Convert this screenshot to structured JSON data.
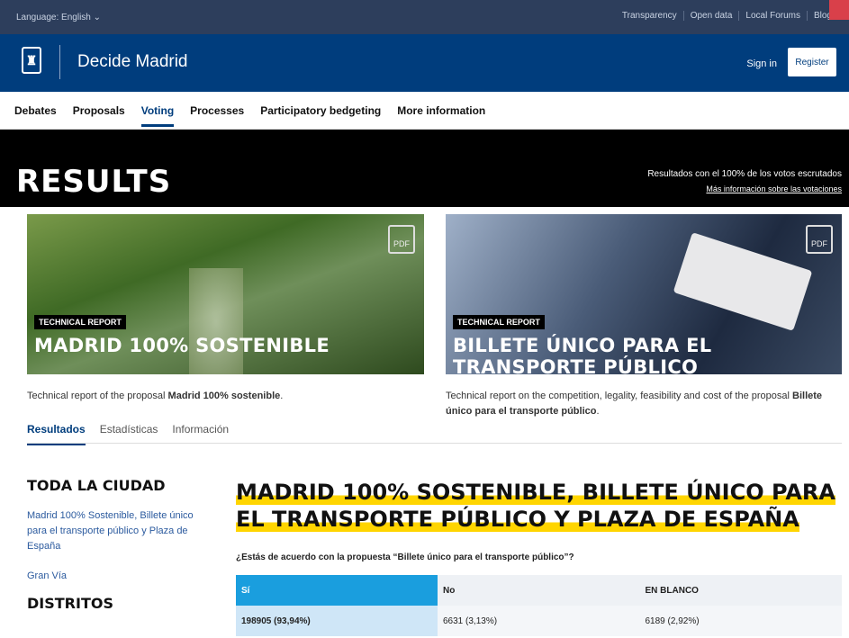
{
  "topbar": {
    "language": "Language: English",
    "links": [
      "Transparency",
      "Open data",
      "Local Forums",
      "Blog"
    ]
  },
  "header": {
    "brand": "Decide Madrid",
    "signin": "Sign in",
    "register": "Register"
  },
  "nav": {
    "items": [
      "Debates",
      "Proposals",
      "Voting",
      "Processes",
      "Participatory bedgeting",
      "More information"
    ],
    "active": "Voting"
  },
  "hero": {
    "title": "RESULTS",
    "note": "Resultados con el 100% de los votos escrutados",
    "link": "Más información sobre las votaciones"
  },
  "cards": [
    {
      "tag": "TECHNICAL REPORT",
      "title": "MADRID 100% SOSTENIBLE",
      "pdf": "PDF",
      "desc_prefix": "Technical report of the proposal ",
      "desc_bold": "Madrid 100% sostenible",
      "desc_suffix": "."
    },
    {
      "tag": "TECHNICAL REPORT",
      "title": "BILLETE ÚNICO PARA EL TRANSPORTE PÚBLICO",
      "pdf": "PDF",
      "desc_prefix": "Technical report on the competition, legality, feasibility and cost of the proposal ",
      "desc_bold": "Billete único para el transporte público",
      "desc_suffix": "."
    }
  ],
  "tabs": [
    "Resultados",
    "Estadísticas",
    "Información"
  ],
  "sidebar": {
    "heading_city": "TODA LA CIUDAD",
    "link_all": "Madrid 100% Sostenible, Billete único para el transporte público y Plaza de España",
    "link_granvia": "Gran Vía",
    "heading_districts": "DISTRITOS"
  },
  "main": {
    "title": "MADRID 100% SOSTENIBLE, BILLETE ÚNICO PARA EL TRANSPORTE PÚBLICO Y PLAZA DE ESPAÑA",
    "question": "¿Estás de acuerdo con la propuesta “Billete único para el transporte público”?",
    "table": {
      "headers": [
        "Sí",
        "No",
        "EN BLANCO"
      ],
      "row": [
        "198905 (93,94%)",
        "6631 (3,13%)",
        "6189 (2,92%)"
      ]
    }
  }
}
